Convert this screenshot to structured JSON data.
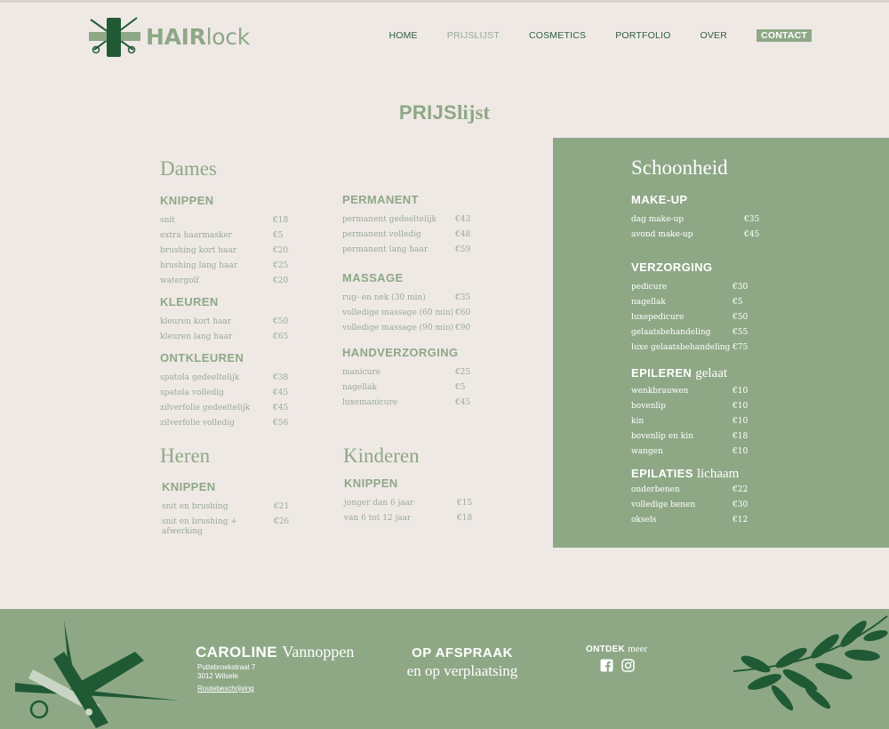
{
  "brand": {
    "bold": "HAIR",
    "light": "lock"
  },
  "nav": {
    "items": [
      "HOME",
      "PRIJSLIJST",
      "COSMETICS",
      "PORTFOLIO",
      "OVER"
    ],
    "contact": "CONTACT",
    "active_index": 1
  },
  "title": {
    "bold": "PRIJS",
    "light": "lijst"
  },
  "dames": {
    "title": "Dames",
    "knippen": {
      "title": "KNIPPEN",
      "items": [
        {
          "name": "snit",
          "price": "€18"
        },
        {
          "name": "extra haarmasker",
          "price": "€5"
        },
        {
          "name": "brushing kort haar",
          "price": "€20"
        },
        {
          "name": "brushing lang haar",
          "price": "€25"
        },
        {
          "name": "watergolf",
          "price": "€20"
        }
      ]
    },
    "kleuren": {
      "title": "KLEUREN",
      "items": [
        {
          "name": "kleuren kort haar",
          "price": "€50"
        },
        {
          "name": "kleuren lang haar",
          "price": "€65"
        }
      ]
    },
    "ontkleuren": {
      "title": "ONTKLEUREN",
      "items": [
        {
          "name": "spatola gedeeltelijk",
          "price": "€38"
        },
        {
          "name": "spatola volledig",
          "price": "€45"
        },
        {
          "name": "zilverfolie gedeeltelijk",
          "price": "€45"
        },
        {
          "name": "zilverfolie volledig",
          "price": "€56"
        }
      ]
    },
    "permanent": {
      "title": "PERMANENT",
      "items": [
        {
          "name": "permanent gedeeltelijk",
          "price": "€43"
        },
        {
          "name": "permanent volledig",
          "price": "€48"
        },
        {
          "name": "permanent lang haar",
          "price": "€59"
        }
      ]
    },
    "massage": {
      "title": "MASSAGE",
      "items": [
        {
          "name": "rug- en nek (30 min)",
          "price": "€35"
        },
        {
          "name": "volledige massage (60 min)",
          "price": "€60"
        },
        {
          "name": "volledige massage (90 min)",
          "price": "€90"
        }
      ]
    },
    "handverzorging": {
      "title": "HANDVERZORGING",
      "items": [
        {
          "name": "manicure",
          "price": "€25"
        },
        {
          "name": "nagellak",
          "price": "€5"
        },
        {
          "name": "luxemanicure",
          "price": "€45"
        }
      ]
    }
  },
  "heren": {
    "title": "Heren",
    "knippen": {
      "title": "KNIPPEN",
      "items": [
        {
          "name": "snit en brushing",
          "price": "€21"
        },
        {
          "name": "snit en brushing + afwerking",
          "price": "€26"
        }
      ]
    }
  },
  "kinderen": {
    "title": "Kinderen",
    "knippen": {
      "title": "KNIPPEN",
      "items": [
        {
          "name": "jonger dan 6 jaar",
          "price": "€15"
        },
        {
          "name": "van 6 tot 12 jaar",
          "price": "€18"
        }
      ]
    }
  },
  "schoonheid": {
    "title": "Schoonheid",
    "makeup": {
      "title": "MAKE-UP",
      "items": [
        {
          "name": "dag make-up",
          "price": "€35"
        },
        {
          "name": "avond make-up",
          "price": "€45"
        }
      ]
    },
    "verzorging": {
      "title": "VERZORGING",
      "items": [
        {
          "name": "pedicure",
          "price": "€30"
        },
        {
          "name": "nagellak",
          "price": "€5"
        },
        {
          "name": "luxepedicure",
          "price": "€50"
        },
        {
          "name": "gelaatsbehandeling",
          "price": "€55"
        },
        {
          "name": "luxe gelaatsbehandeling",
          "price": "€75"
        }
      ]
    },
    "epileren": {
      "title_bold": "EPILEREN",
      "title_light": "gelaat",
      "items": [
        {
          "name": "wenkbrauwen",
          "price": "€10"
        },
        {
          "name": "bovenlip",
          "price": "€10"
        },
        {
          "name": "kin",
          "price": "€10"
        },
        {
          "name": "bovenlip en kin",
          "price": "€18"
        },
        {
          "name": "wangen",
          "price": "€10"
        }
      ]
    },
    "epilaties": {
      "title_bold": "EPILATIES",
      "title_light": "lichaam",
      "items": [
        {
          "name": "onderbenen",
          "price": "€22"
        },
        {
          "name": "volledige benen",
          "price": "€30"
        },
        {
          "name": "oksels",
          "price": "€12"
        }
      ]
    }
  },
  "footer": {
    "name_bold": "CAROLINE",
    "name_light": "Vannoppen",
    "address_line1": "Puttebroekstraat 7",
    "address_line2": "3012 Wilsele",
    "route_link": "Routebeschrijving",
    "appointment_bold": "OP AFSPRAAK",
    "appointment_light": "en op verplaatsing",
    "discover_bold": "ONTDEK",
    "discover_light": "meer",
    "icons": [
      "facebook-icon",
      "instagram-icon"
    ]
  },
  "colors": {
    "sage": "#8ea886",
    "dark_green": "#1f5a34",
    "background": "#efe9e6"
  }
}
